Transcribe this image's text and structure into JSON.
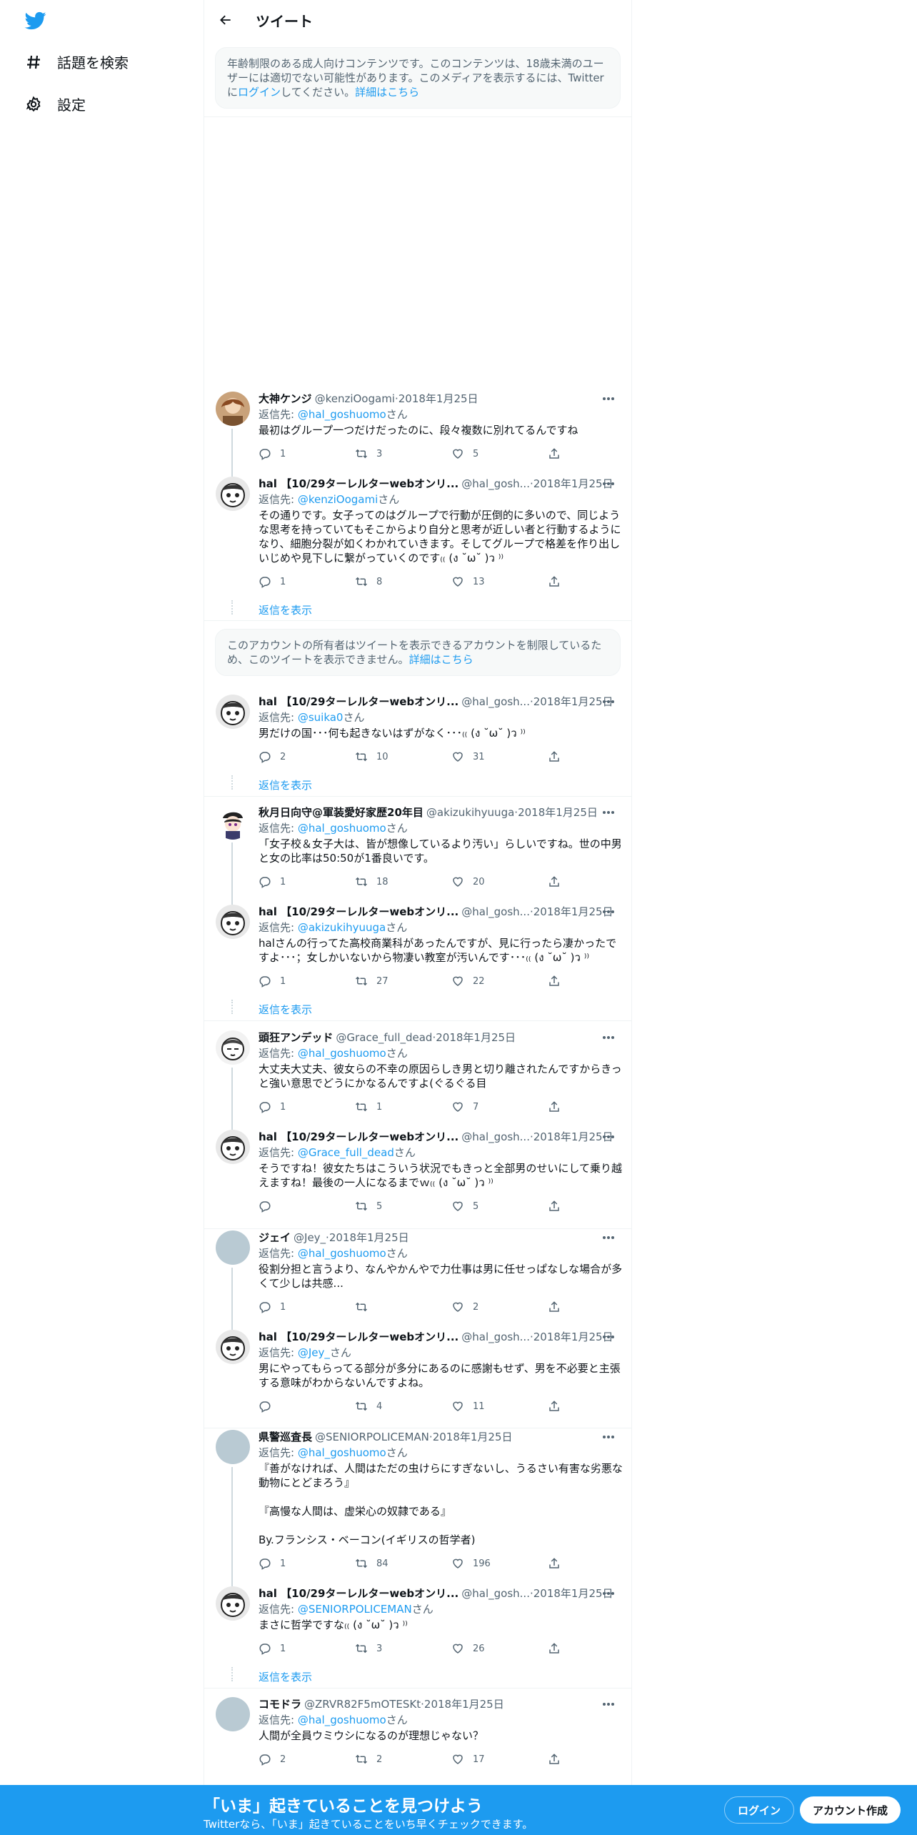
{
  "sidebar": {
    "logo": "twitter-bird-icon",
    "items": [
      {
        "label": "話題を検索",
        "icon": "hashtag-icon"
      },
      {
        "label": "設定",
        "icon": "gear-icon"
      }
    ]
  },
  "header": {
    "title": "ツイート",
    "back_icon": "arrow-left-icon"
  },
  "age_notice": {
    "text": "年齢制限のある成人向けコンテンツです。このコンテンツは、18歳未満のユーザーには適切でない可能性があります。このメディアを表示するには、Twitterに",
    "login": "ログイン",
    "after": "してください。",
    "more": "詳細はこちら"
  },
  "restricted_notice": {
    "text": "このアカウントの所有者はツイートを表示できるアカウントを制限しているため、このツイートを表示できません。",
    "more": "詳細はこちら"
  },
  "common": {
    "reply_prefix": "返信先: ",
    "reply_suffix": "さん",
    "show_replies": "返信を表示",
    "dot": " · "
  },
  "tweets": [
    {
      "name": "大神ケンジ",
      "handle": "@kenziOogami",
      "date": "2018年1月25日",
      "reply_to": "@hal_goshuomo",
      "text": "最初はグループ一つだけだったのに、段々複数に別れてるんですね",
      "replies": "1",
      "retweets": "3",
      "likes": "5"
    },
    {
      "name": "hal 【10/29ターレルターwebオンリ...",
      "handle": "@hal_gosh...",
      "date": "2018年1月25日",
      "reply_to": "@kenziOogami",
      "text": "その通りです。女子ってのはグループで行動が圧倒的に多いので、同じような思考を持っていてもそこからより自分と思考が近しい者と行動するようになり、細胞分裂が如くわかれていきます。そしてグループで格差を作り出しいじめや見下しに繋がっていくのです₍₍ (ง ˘ω˘ )ว ⁾⁾",
      "replies": "1",
      "retweets": "8",
      "likes": "13"
    },
    {
      "name": "hal 【10/29ターレルターwebオンリ...",
      "handle": "@hal_gosh...",
      "date": "2018年1月25日",
      "reply_to": "@suika0",
      "text": "男だけの国･･･何も起きないはずがなく･･･₍₍ (ง ˘ω˘ )ว ⁾⁾",
      "replies": "2",
      "retweets": "10",
      "likes": "31"
    },
    {
      "name": "秋月日向守@軍装愛好家歴20年目",
      "handle": "@akizukihyuuga",
      "date": "2018年1月25日",
      "reply_to": "@hal_goshuomo",
      "text": "「女子校＆女子大は、皆が想像しているより汚い」らしいですね。世の中男と女の比率は50:50が1番良いです。",
      "replies": "1",
      "retweets": "18",
      "likes": "20"
    },
    {
      "name": "hal 【10/29ターレルターwebオンリ...",
      "handle": "@hal_gosh...",
      "date": "2018年1月25日",
      "reply_to": "@akizukihyuuga",
      "text": "halさんの行ってた高校商業科があったんですが、見に行ったら凄かったですよ･･･；女しかいないから物凄い教室が汚いんです･･･₍₍ (ง ˘ω˘ )ว ⁾⁾",
      "replies": "1",
      "retweets": "27",
      "likes": "22"
    },
    {
      "name": "頭狂アンデッド",
      "handle": "@Grace_full_dead",
      "date": "2018年1月25日",
      "reply_to": "@hal_goshuomo",
      "text": "大丈夫大丈夫、彼女らの不幸の原因らしき男と切り離されたんですからきっと強い意思でどうにかなるんですよ(ぐるぐる目",
      "replies": "1",
      "retweets": "1",
      "likes": "7"
    },
    {
      "name": "hal 【10/29ターレルターwebオンリ...",
      "handle": "@hal_gosh...",
      "date": "2018年1月25日",
      "reply_to": "@Grace_full_dead",
      "text": "そうですね！彼女たちはこういう状況でもきっと全部男のせいにして乗り越えますね！最後の一人になるまでｗ₍₍ (ง ˘ω˘ )ว ⁾⁾",
      "replies": "",
      "retweets": "5",
      "likes": "5"
    },
    {
      "name": "ジェイ",
      "handle": "@Jey_",
      "date": "2018年1月25日",
      "reply_to": "@hal_goshuomo",
      "text": "役割分担と言うより、なんやかんやで力仕事は男に任せっぱなしな場合が多くて少しは共感...",
      "replies": "1",
      "retweets": "",
      "likes": "2"
    },
    {
      "name": "hal 【10/29ターレルターwebオンリ...",
      "handle": "@hal_gosh...",
      "date": "2018年1月25日",
      "reply_to": "@Jey_",
      "text": "男にやってもらってる部分が多分にあるのに感謝もせず、男を不必要と主張する意味がわからないんですよね。",
      "replies": "",
      "retweets": "4",
      "likes": "11"
    },
    {
      "name": "県警巡査長",
      "handle": "@SENIORPOLICEMAN",
      "date": "2018年1月25日",
      "reply_to": "@hal_goshuomo",
      "text": "『善がなければ、人間はただの虫けらにすぎないし、うるさい有害な劣悪な動物にとどまろう』\n\n『高慢な人間は、虚栄心の奴隷である』\n\nBy.フランシス・ベーコン(イギリスの哲学者)",
      "replies": "1",
      "retweets": "84",
      "likes": "196"
    },
    {
      "name": "hal 【10/29ターレルターwebオンリ...",
      "handle": "@hal_gosh...",
      "date": "2018年1月25日",
      "reply_to": "@SENIORPOLICEMAN",
      "text": "まさに哲学ですな₍₍ (ง ˘ω˘ )ว ⁾⁾",
      "replies": "1",
      "retweets": "3",
      "likes": "26"
    },
    {
      "name": "コモドラ",
      "handle": "@ZRVR82F5mOTESKt",
      "date": "2018年1月25日",
      "reply_to": "@hal_goshuomo",
      "text": "人間が全員ウミウシになるのが理想じゃない？",
      "replies": "2",
      "retweets": "2",
      "likes": "17"
    }
  ],
  "bottom_bar": {
    "title": "「いま」起きていることを見つけよう",
    "subtitle": "Twitterなら、「いま」起きていることをいち早くチェックできます。",
    "login": "ログイン",
    "signup": "アカウント作成"
  },
  "colors": {
    "accent": "#1d9bf0",
    "text": "#0f1419",
    "muted": "#536471",
    "border": "#eff3f4"
  }
}
